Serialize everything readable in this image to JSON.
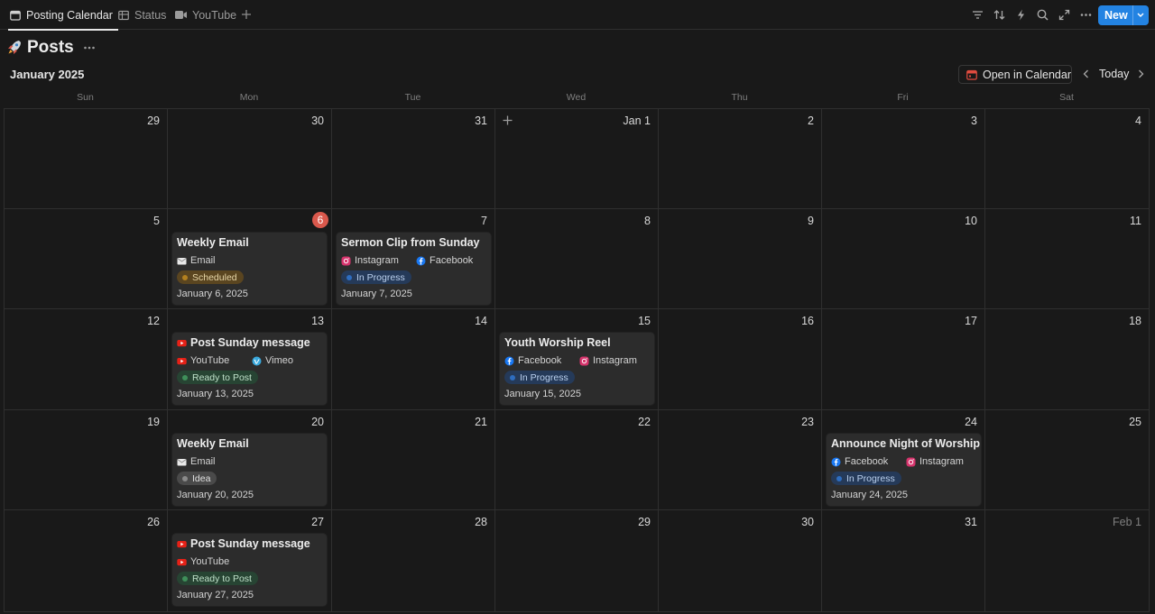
{
  "tabs": [
    {
      "label": "Posting Calendar",
      "icon": "calendar-icon",
      "active": true
    },
    {
      "label": "Status",
      "icon": "table-icon",
      "active": false
    },
    {
      "label": "YouTube",
      "icon": "video-icon",
      "active": false
    }
  ],
  "toolbar": {
    "new_label": "New",
    "icons": [
      "filter-icon",
      "sort-icon",
      "automation-icon",
      "search-icon",
      "expand-icon",
      "more-icon"
    ]
  },
  "page": {
    "title": "Posts",
    "icon": "rocket-icon",
    "month": "January 2025",
    "open_in_calendar": "Open in Calendar",
    "today": "Today"
  },
  "weekdays": [
    "Sun",
    "Mon",
    "Tue",
    "Wed",
    "Thu",
    "Fri",
    "Sat"
  ],
  "colors": {
    "accent": "#2383e2",
    "today": "#d9584c",
    "status_scheduled": "#b3801f",
    "status_in_progress": "#2e6dbf",
    "status_ready": "#3f8f5a",
    "status_idea": "#8a8a8a"
  },
  "weeks": [
    [
      {
        "label": "29",
        "muted": false
      },
      {
        "label": "30",
        "muted": false
      },
      {
        "label": "31",
        "muted": false
      },
      {
        "label": "Jan 1",
        "muted": false,
        "add": true
      },
      {
        "label": "2",
        "muted": false
      },
      {
        "label": "3",
        "muted": false
      },
      {
        "label": "4",
        "muted": false
      }
    ],
    [
      {
        "label": "5"
      },
      {
        "label": "6",
        "today": true,
        "post": {
          "title": "Weekly Email",
          "title_icon": "",
          "platforms": [
            {
              "name": "Email",
              "icon": "email-icon"
            }
          ],
          "status": "Scheduled",
          "status_key": "scheduled",
          "date": "January 6, 2025"
        }
      },
      {
        "label": "7",
        "post": {
          "title": "Sermon Clip from Sunday",
          "title_icon": "",
          "platforms": [
            {
              "name": "Instagram",
              "icon": "instagram-icon"
            },
            {
              "name": "Facebook",
              "icon": "facebook-icon"
            }
          ],
          "status": "In Progress",
          "status_key": "in_progress",
          "date": "January 7, 2025"
        }
      },
      {
        "label": "8"
      },
      {
        "label": "9"
      },
      {
        "label": "10"
      },
      {
        "label": "11"
      }
    ],
    [
      {
        "label": "12"
      },
      {
        "label": "13",
        "post": {
          "title": "Post Sunday message",
          "title_icon": "youtube-icon",
          "platforms": [
            {
              "name": "YouTube",
              "icon": "youtube-icon"
            },
            {
              "name": "Vimeo",
              "icon": "vimeo-icon"
            }
          ],
          "status": "Ready to Post",
          "status_key": "ready",
          "date": "January 13, 2025"
        }
      },
      {
        "label": "14"
      },
      {
        "label": "15",
        "post": {
          "title": "Youth Worship Reel",
          "title_icon": "",
          "platforms": [
            {
              "name": "Facebook",
              "icon": "facebook-icon"
            },
            {
              "name": "Instagram",
              "icon": "instagram-icon"
            }
          ],
          "status": "In Progress",
          "status_key": "in_progress",
          "date": "January 15, 2025"
        }
      },
      {
        "label": "16"
      },
      {
        "label": "17"
      },
      {
        "label": "18"
      }
    ],
    [
      {
        "label": "19"
      },
      {
        "label": "20",
        "post": {
          "title": "Weekly Email",
          "title_icon": "",
          "platforms": [
            {
              "name": "Email",
              "icon": "email-icon"
            }
          ],
          "status": "Idea",
          "status_key": "idea",
          "date": "January 20, 2025"
        }
      },
      {
        "label": "21"
      },
      {
        "label": "22"
      },
      {
        "label": "23"
      },
      {
        "label": "24",
        "post": {
          "title": "Announce Night of Worship",
          "title_icon": "",
          "platforms": [
            {
              "name": "Facebook",
              "icon": "facebook-icon"
            },
            {
              "name": "Instagram",
              "icon": "instagram-icon"
            }
          ],
          "status": "In Progress",
          "status_key": "in_progress",
          "date": "January 24, 2025"
        }
      },
      {
        "label": "25"
      }
    ],
    [
      {
        "label": "26"
      },
      {
        "label": "27",
        "post": {
          "title": "Post Sunday message",
          "title_icon": "youtube-icon",
          "platforms": [
            {
              "name": "YouTube",
              "icon": "youtube-icon"
            }
          ],
          "status": "Ready to Post",
          "status_key": "ready",
          "date": "January 27, 2025"
        }
      },
      {
        "label": "28"
      },
      {
        "label": "29"
      },
      {
        "label": "30"
      },
      {
        "label": "31"
      },
      {
        "label": "Feb 1",
        "muted": true
      }
    ]
  ]
}
